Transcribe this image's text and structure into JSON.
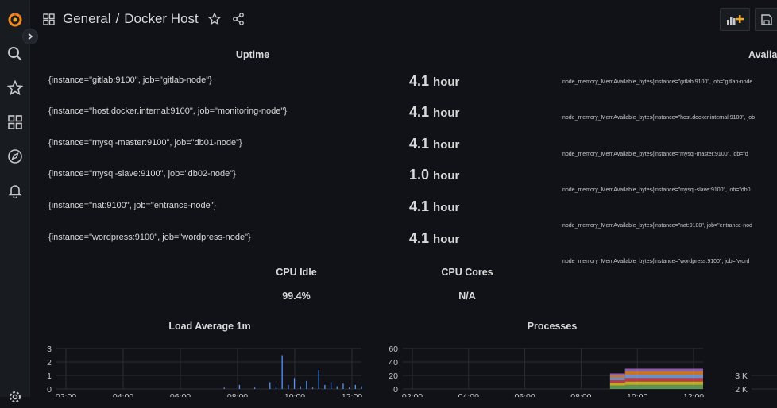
{
  "header": {
    "breadcrumb_folder": "General",
    "breadcrumb_sep": "/",
    "dashboard_title": "Docker Host"
  },
  "sidebar": {
    "items": [
      {
        "icon": "grafana-logo-icon"
      },
      {
        "icon": "search-icon"
      },
      {
        "icon": "star-icon"
      },
      {
        "icon": "dashboards-icon"
      },
      {
        "icon": "explore-compass-icon"
      },
      {
        "icon": "alerting-bell-icon"
      },
      {
        "icon": "gear-icon"
      }
    ]
  },
  "panels": {
    "uptime": {
      "title": "Uptime",
      "rows": [
        {
          "label": "{instance=\"gitlab:9100\", job=\"gitlab-node\"}",
          "value": "4.1",
          "unit": "hour"
        },
        {
          "label": "{instance=\"host.docker.internal:9100\", job=\"monitoring-node\"}",
          "value": "4.1",
          "unit": "hour"
        },
        {
          "label": "{instance=\"mysql-master:9100\", job=\"db01-node\"}",
          "value": "4.1",
          "unit": "hour"
        },
        {
          "label": "{instance=\"mysql-slave:9100\", job=\"db02-node\"}",
          "value": "1.0",
          "unit": "hour"
        },
        {
          "label": "{instance=\"nat:9100\", job=\"entrance-node\"}",
          "value": "4.1",
          "unit": "hour"
        },
        {
          "label": "{instance=\"wordpress:9100\", job=\"wordpress-node\"}",
          "value": "4.1",
          "unit": "hour"
        }
      ]
    },
    "available": {
      "title": "Availab",
      "rows": [
        "node_memory_MemAvailable_bytes{instance=\"gitlab:9100\", job=\"gitlab-node",
        "node_memory_MemAvailable_bytes{instance=\"host.docker.internal:9100\", job",
        "node_memory_MemAvailable_bytes{instance=\"mysql-master:9100\", job=\"d",
        "node_memory_MemAvailable_bytes{instance=\"mysql-slave:9100\", job=\"db0",
        "node_memory_MemAvailable_bytes{instance=\"nat:9100\", job=\"entrance-nod",
        "node_memory_MemAvailable_bytes{instance=\"wordpress:9100\", job=\"word"
      ]
    },
    "cpu_idle": {
      "title": "CPU Idle",
      "value": "99.4%",
      "color": "#d8d9da"
    },
    "cpu_cores": {
      "title": "CPU Cores",
      "value": "N/A",
      "color": "#d8d9da"
    },
    "load_avg": {
      "title": "Load Average 1m"
    },
    "processes": {
      "title": "Processes"
    }
  },
  "chart_data": [
    {
      "type": "line",
      "title": "Load Average 1m",
      "yticks": [
        "3",
        "2",
        "1",
        "0"
      ],
      "ylim": [
        0,
        3
      ],
      "xticks": [
        "02:00",
        "04:00",
        "06:00",
        "08:00",
        "10:00",
        "12:00"
      ],
      "series": [
        {
          "color": "#5794f2",
          "x": [
            0.55,
            0.6,
            0.65,
            0.7,
            0.72,
            0.74,
            0.76,
            0.78,
            0.8,
            0.82,
            0.84,
            0.86,
            0.88,
            0.9,
            0.92,
            0.94,
            0.96,
            0.98,
            1.0
          ],
          "values": [
            0.1,
            0.3,
            0.1,
            0.5,
            0.2,
            2.5,
            0.3,
            0.8,
            0.2,
            0.6,
            0.1,
            1.4,
            0.3,
            0.5,
            0.2,
            0.4,
            0.1,
            0.3,
            0.2
          ]
        }
      ]
    },
    {
      "type": "area",
      "title": "Processes",
      "yticks": [
        "60",
        "40",
        "20",
        "0"
      ],
      "ylim": [
        0,
        60
      ],
      "xticks": [
        "02:00",
        "04:00",
        "06:00",
        "08:00",
        "10:00",
        "12:00"
      ],
      "stack_start": 0.69,
      "stack_step": 0.74,
      "layers": [
        {
          "color": "#73bf69",
          "before": 5,
          "after": 6
        },
        {
          "color": "#fade2a",
          "before": 4,
          "after": 5
        },
        {
          "color": "#f2495c",
          "before": 4,
          "after": 5
        },
        {
          "color": "#8ab8ff",
          "before": 4,
          "after": 5
        },
        {
          "color": "#ff9830",
          "before": 3,
          "after": 5
        },
        {
          "color": "#b877d9",
          "before": 3,
          "after": 4
        }
      ]
    },
    {
      "type": "area",
      "title": "",
      "yticks": [
        "3 K",
        "2 K"
      ]
    }
  ]
}
